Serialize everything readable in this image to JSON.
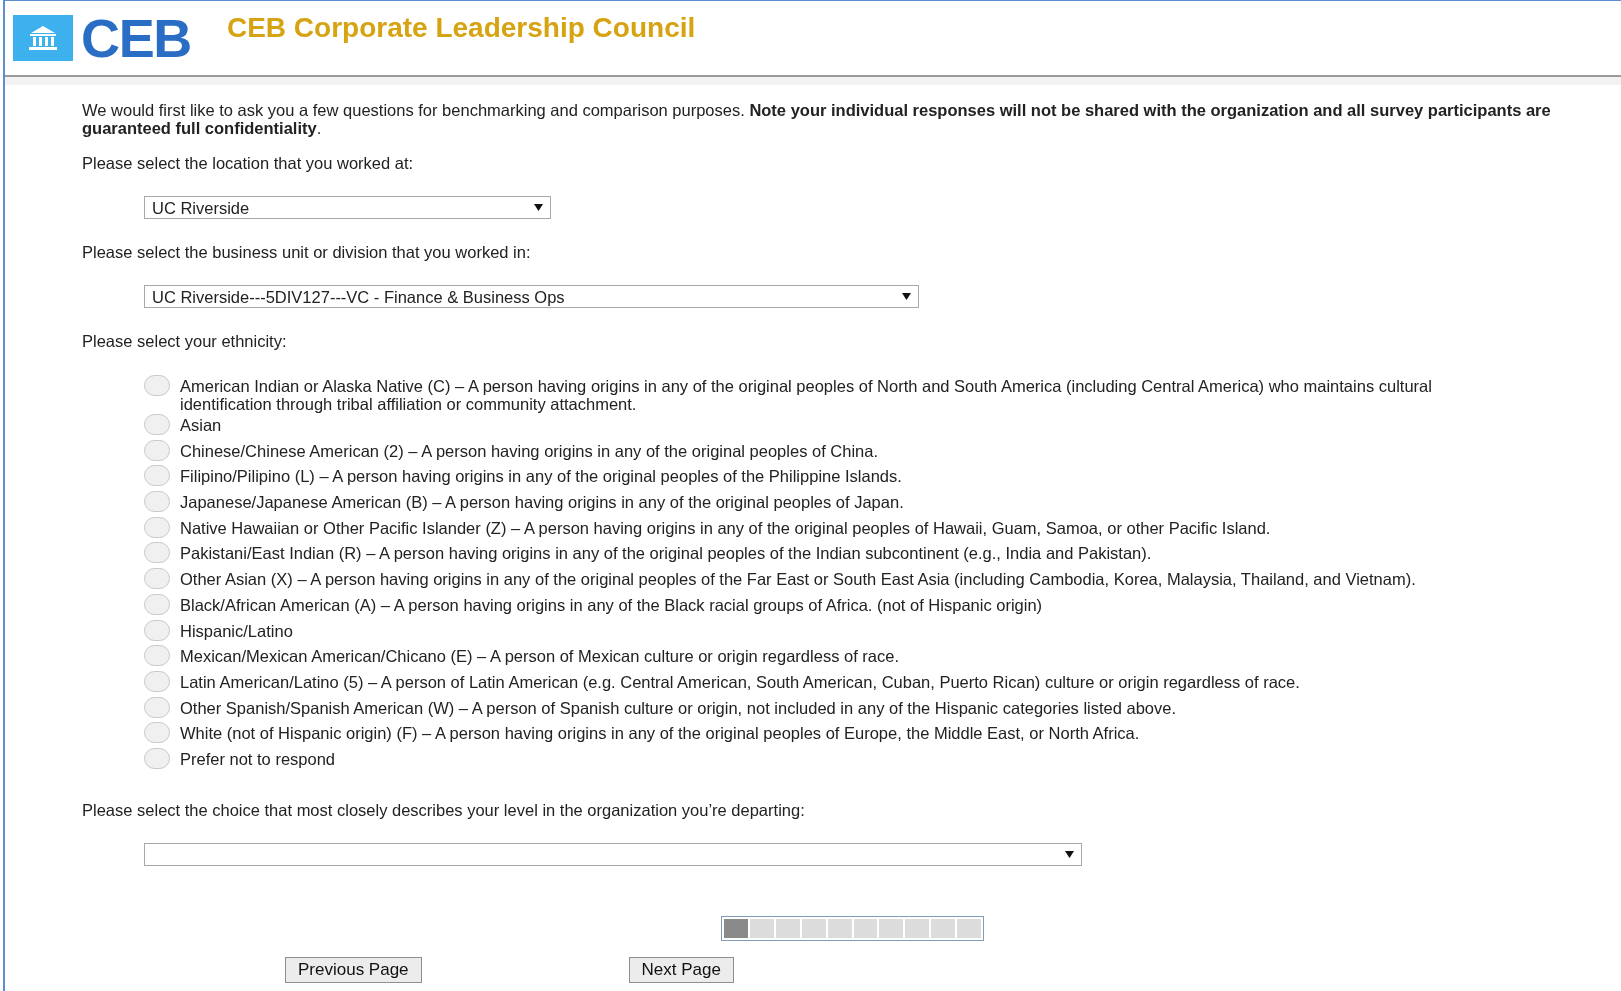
{
  "header": {
    "logo_text": "CEB",
    "title": "CEB Corporate Leadership Council"
  },
  "intro": "We would first like to ask you a few questions for benchmarking and comparison purposes. **Note your individual responses will not be shared with the organization and all survey participants are guaranteed full confidentiality**.",
  "questions": [
    {
      "kind": "select",
      "prompt": "Please select the location that you worked at:",
      "value": "UC Riverside"
    },
    {
      "kind": "select",
      "prompt": "Please select the business unit or division that you worked in:",
      "value": "UC Riverside---5DIV127---VC - Finance & Business Ops"
    },
    {
      "kind": "radio",
      "prompt": "Please select your ethnicity:",
      "options": [
        {
          "label": "American Indian or Alaska Native (C) – A person having origins in any of the original peoples of North and South America (including Central America) who maintains cultural identification through tribal affiliation or community attachment.",
          "selected": false
        },
        {
          "label": "Asian",
          "selected": false
        },
        {
          "label": "Chinese/Chinese American (2) – A person having origins in any of the original peoples of China.",
          "selected": false
        },
        {
          "label": "Filipino/Pilipino (L) – A person having origins in any of the original peoples of the Philippine Islands.",
          "selected": false
        },
        {
          "label": "Japanese/Japanese American (B) – A person having origins in any of the original peoples of Japan.",
          "selected": false
        },
        {
          "label": "Native Hawaiian or Other Pacific Islander (Z) – A person having origins in any of the original peoples of Hawaii, Guam, Samoa, or other Pacific Island.",
          "selected": false
        },
        {
          "label": "Pakistani/East Indian (R) – A person having origins in any of the original peoples of the Indian subcontinent (e.g., India and Pakistan).",
          "selected": false
        },
        {
          "label": "Other Asian (X) – A person having origins in any of the original peoples of the Far East or South East Asia (including Cambodia, Korea, Malaysia, Thailand, and Vietnam).",
          "selected": false
        },
        {
          "label": "Black/African American (A) – A person having origins in any of the Black racial groups of Africa. (not of Hispanic origin)",
          "selected": false
        },
        {
          "label": "Hispanic/Latino",
          "selected": false
        },
        {
          "label": "Mexican/Mexican American/Chicano (E) – A person of Mexican culture or origin regardless of race.",
          "selected": false
        },
        {
          "label": "Latin American/Latino (5) – A person of Latin American (e.g. Central American, South American, Cuban, Puerto Rican) culture or origin regardless of race.",
          "selected": false
        },
        {
          "label": "Other Spanish/Spanish American (W) – A person of Spanish culture or origin, not included in any of the Hispanic categories listed above.",
          "selected": false
        },
        {
          "label": "White (not of Hispanic origin) (F) – A person having origins in any of the original peoples of Europe, the Middle East, or North Africa.",
          "selected": false
        },
        {
          "label": "Prefer not to respond",
          "selected": false
        }
      ]
    },
    {
      "kind": "select",
      "prompt": "Please select the choice that most closely describes your level in the organization you’re departing:"
    }
  ],
  "progress": {
    "level": 0.1
  },
  "buttons": [
    "Previous Page",
    "Next Page"
  ]
}
